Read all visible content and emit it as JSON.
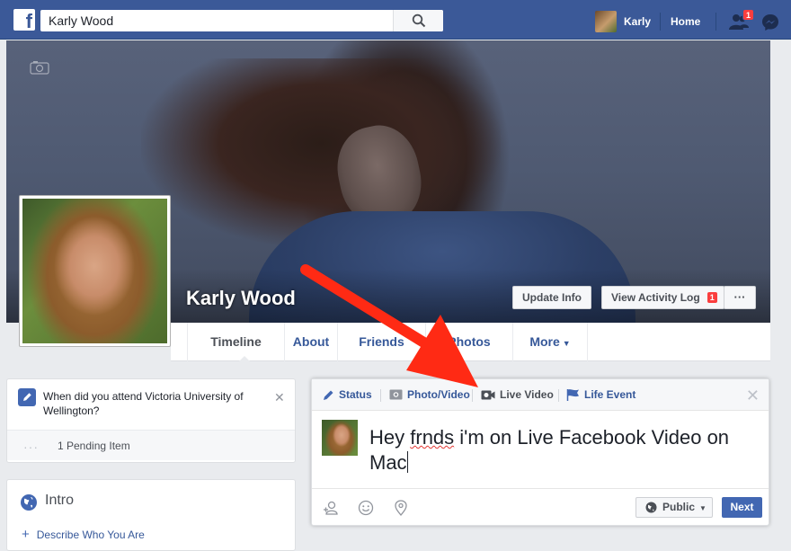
{
  "topbar": {
    "search_value": "Karly Wood",
    "user_name": "Karly",
    "home_label": "Home",
    "friend_requests_badge": "1"
  },
  "profile": {
    "name": "Karly Wood",
    "update_info": "Update Info",
    "view_activity_log": "View Activity Log",
    "activity_badge": "1",
    "more_dots": "···"
  },
  "tabs": [
    {
      "label": "Timeline"
    },
    {
      "label": "About"
    },
    {
      "label": "Friends"
    },
    {
      "label": "Photos"
    },
    {
      "label": "More"
    }
  ],
  "question_card": {
    "text": "When did you attend Victoria University of Wellington?",
    "pending": "1 Pending Item",
    "pending_dots": "···"
  },
  "intro": {
    "title": "Intro",
    "describe": "Describe Who You Are"
  },
  "composer": {
    "tabs": [
      "Status",
      "Photo/Video",
      "Live Video",
      "Life Event"
    ],
    "text_part1": "Hey ",
    "text_misspelled": "frnds",
    "text_part2": " i'm on Live Facebook Video on Mac",
    "privacy": "Public",
    "next": "Next"
  },
  "colors": {
    "brand": "#3b5998",
    "link": "#365899",
    "arrow": "#ff2a14"
  }
}
